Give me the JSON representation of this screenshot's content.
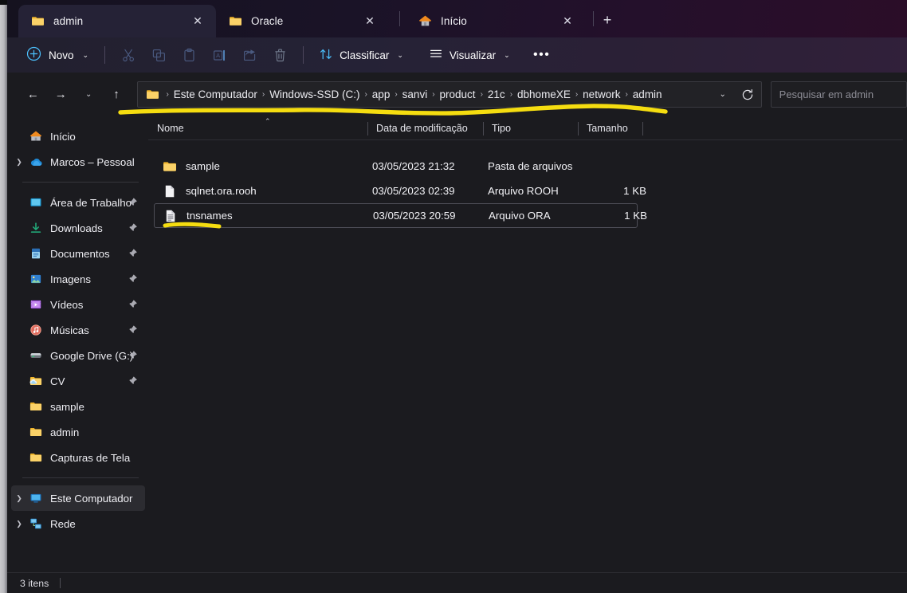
{
  "window": {
    "title": "admin",
    "status_text": "3 itens"
  },
  "tabs": [
    {
      "label": "admin",
      "icon": "folder-icon",
      "active": true
    },
    {
      "label": "Oracle",
      "icon": "folder-icon",
      "active": false
    },
    {
      "label": "Início",
      "icon": "home-icon",
      "active": false
    }
  ],
  "tab_controls": {
    "close_label": "✕",
    "new_tab_label": "+"
  },
  "toolbar": {
    "new_label": "Novo",
    "sort_label": "Classificar",
    "view_label": "Visualizar",
    "more_label": "•••",
    "chevron": "⌄",
    "icons": [
      {
        "name": "cut-icon",
        "label": "Recortar"
      },
      {
        "name": "copy-icon",
        "label": "Copiar"
      },
      {
        "name": "paste-icon",
        "label": "Colar"
      },
      {
        "name": "rename-icon",
        "label": "Renomear"
      },
      {
        "name": "share-icon",
        "label": "Compartilhar"
      },
      {
        "name": "delete-icon",
        "label": "Excluir"
      }
    ]
  },
  "navigation": {
    "back": "←",
    "forward": "→",
    "recent": "⌄",
    "up": "↑",
    "address_chevron": "⌄",
    "separator": "›",
    "breadcrumbs": [
      "Este Computador",
      "Windows-SSD (C:)",
      "app",
      "sanvi",
      "product",
      "21c",
      "dbhomeXE",
      "network",
      "admin"
    ]
  },
  "search": {
    "placeholder": "Pesquisar em admin",
    "value": ""
  },
  "sidebar": {
    "groups": [
      {
        "items": [
          {
            "label": "Início",
            "icon": "home-icon",
            "expandable": false,
            "pinned": false,
            "selected": false
          },
          {
            "label": "Marcos – Pessoal",
            "icon": "onedrive-cloud-icon",
            "expandable": true,
            "pinned": false,
            "selected": false
          }
        ]
      },
      {
        "items": [
          {
            "label": "Área de Trabalho",
            "icon": "desktop-icon",
            "expandable": false,
            "pinned": true,
            "selected": false
          },
          {
            "label": "Downloads",
            "icon": "downloads-icon",
            "expandable": false,
            "pinned": true,
            "selected": false
          },
          {
            "label": "Documentos",
            "icon": "documents-icon",
            "expandable": false,
            "pinned": true,
            "selected": false
          },
          {
            "label": "Imagens",
            "icon": "pictures-icon",
            "expandable": false,
            "pinned": true,
            "selected": false
          },
          {
            "label": "Vídeos",
            "icon": "videos-icon",
            "expandable": false,
            "pinned": true,
            "selected": false
          },
          {
            "label": "Músicas",
            "icon": "music-icon",
            "expandable": false,
            "pinned": true,
            "selected": false
          },
          {
            "label": "Google Drive (G:)",
            "icon": "drive-icon",
            "expandable": false,
            "pinned": true,
            "selected": false
          },
          {
            "label": "CV",
            "icon": "folder-cloud-icon",
            "expandable": false,
            "pinned": true,
            "selected": false
          },
          {
            "label": "sample",
            "icon": "folder-icon",
            "expandable": false,
            "pinned": false,
            "selected": false
          },
          {
            "label": "admin",
            "icon": "folder-icon",
            "expandable": false,
            "pinned": false,
            "selected": false
          },
          {
            "label": "Capturas de Tela",
            "icon": "folder-icon",
            "expandable": false,
            "pinned": false,
            "selected": false
          }
        ]
      },
      {
        "items": [
          {
            "label": "Este Computador",
            "icon": "this-pc-icon",
            "expandable": true,
            "pinned": false,
            "selected": true
          },
          {
            "label": "Rede",
            "icon": "network-icon",
            "expandable": true,
            "pinned": false,
            "selected": false
          }
        ]
      }
    ]
  },
  "filelist": {
    "columns": [
      {
        "key": "name",
        "label": "Nome",
        "sorted": true,
        "sort_dir": "asc"
      },
      {
        "key": "date",
        "label": "Data de modificação",
        "sorted": false
      },
      {
        "key": "type",
        "label": "Tipo",
        "sorted": false
      },
      {
        "key": "size",
        "label": "Tamanho",
        "sorted": false
      }
    ],
    "sort_indicator": "⌃",
    "rows": [
      {
        "name": "sample",
        "date": "03/05/2023 21:32",
        "type": "Pasta de arquivos",
        "size": "",
        "icon": "folder-icon",
        "focused": false
      },
      {
        "name": "sqlnet.ora.rooh",
        "date": "03/05/2023 02:39",
        "type": "Arquivo ROOH",
        "size": "1 KB",
        "icon": "blank-file-icon",
        "focused": false
      },
      {
        "name": "tnsnames",
        "date": "03/05/2023 20:59",
        "type": "Arquivo ORA",
        "size": "1 KB",
        "icon": "text-file-icon",
        "focused": true
      }
    ]
  },
  "annotations": [
    {
      "name": "breadcrumb-highlight",
      "color": "#f5dd10",
      "shape": "underline-stroke"
    },
    {
      "name": "tnsnames-highlight",
      "color": "#f5dd10",
      "shape": "underline-stroke"
    }
  ],
  "colors": {
    "accent_blue": "#4cc2ff",
    "folder_yellow": "#f7cd63",
    "annotation_yellow": "#f5dd10",
    "window_bg": "#1b1b1f",
    "titlebar_purple": "#2b0d28"
  }
}
